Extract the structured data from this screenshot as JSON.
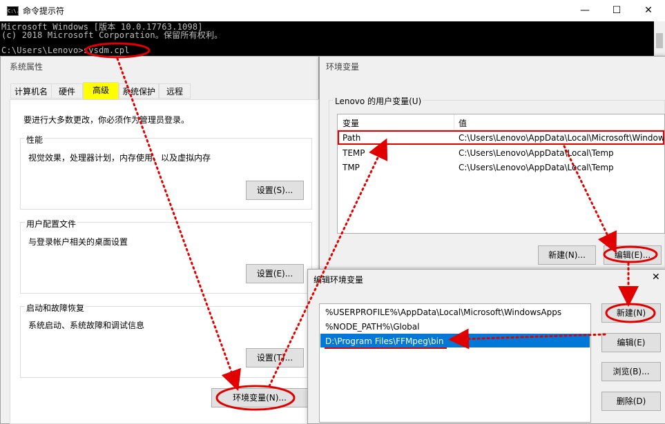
{
  "cmd": {
    "title": "命令提示符",
    "icon_text": "C:\\.",
    "lines": [
      "Microsoft Windows [版本 10.0.17763.1098]",
      "(c) 2018 Microsoft Corporation。保留所有权利。",
      "",
      "C:\\Users\\Lenovo>sysdm.cpl"
    ],
    "controls": {
      "minimize": "—",
      "maximize": "☐",
      "close": "✕"
    }
  },
  "sys_props": {
    "title": "系统属性",
    "tabs": [
      "计算机名",
      "硬件",
      "高级",
      "系统保护",
      "远程"
    ],
    "admin_note": "要进行大多数更改，你必须作为管理员登录。",
    "performance": {
      "label": "性能",
      "desc": "视觉效果，处理器计划，内存使用，以及虚拟内存",
      "button": "设置(S)..."
    },
    "user_profiles": {
      "label": "用户配置文件",
      "desc": "与登录帐户相关的桌面设置",
      "button": "设置(E)..."
    },
    "startup": {
      "label": "启动和故障恢复",
      "desc": "系统启动、系统故障和调试信息",
      "button": "设置(T)..."
    },
    "env_button": "环境变量(N)..."
  },
  "env_vars": {
    "title": "环境变量",
    "user_group": "Lenovo 的用户变量(U)",
    "col_var": "变量",
    "col_val": "值",
    "rows": [
      {
        "name": "Path",
        "value": "C:\\Users\\Lenovo\\AppData\\Local\\Microsoft\\Windows"
      },
      {
        "name": "TEMP",
        "value": "C:\\Users\\Lenovo\\AppData\\Local\\Temp"
      },
      {
        "name": "TMP",
        "value": "C:\\Users\\Lenovo\\AppData\\Local\\Temp"
      }
    ],
    "new_button": "新建(N)...",
    "edit_button": "编辑(E)..."
  },
  "edit_env": {
    "title": "编辑环境变量",
    "close": "✕",
    "items": [
      "%USERPROFILE%\\AppData\\Local\\Microsoft\\WindowsApps",
      "%NODE_PATH%\\Global",
      "D:\\Program Files\\FFMpeg\\bin"
    ],
    "buttons": {
      "new": "新建(N)",
      "edit": "编辑(E)",
      "browse": "浏览(B)...",
      "delete": "删除(D)"
    }
  },
  "colors": {
    "annotation": "#e00000",
    "tab_highlight": "#ffff00",
    "selection": "#0078d7"
  }
}
